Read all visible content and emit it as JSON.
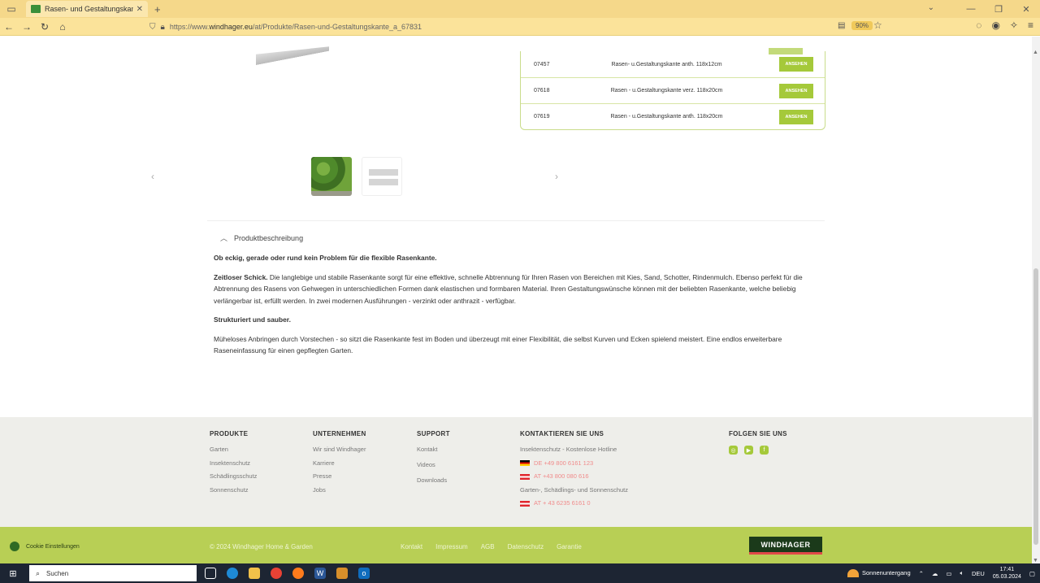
{
  "browser": {
    "tab_title": "Rasen- und Gestaltungskante | W",
    "tab_close": "✕",
    "new_tab": "+",
    "url_prefix": "https://www.",
    "url_domain": "windhager.eu",
    "url_rest": "/at/Produkte/Rasen-und-Gestaltungskante_a_67831",
    "zoom": "90%"
  },
  "variants": [
    {
      "number": "07457",
      "description": "Rasen- u.Gestaltungskante anth. 118x12cm",
      "button": "ANSEHEN"
    },
    {
      "number": "07618",
      "description": "Rasen - u.Gestaltungskante verz. 118x20cm",
      "button": "ANSEHEN"
    },
    {
      "number": "07619",
      "description": "Rasen - u.Gestaltungskante anth. 118x20cm",
      "button": "ANSEHEN"
    }
  ],
  "description": {
    "toggle_label": "Produktbeschreibung",
    "heading": "Ob eckig, gerade oder rund kein Problem für die flexible Rasenkante.",
    "p1_bold": "Zeitloser Schick.",
    "p1_text": " Die langlebige und stabile Rasenkante sorgt für eine effektive, schnelle Abtrennung für Ihren Rasen von Bereichen mit Kies, Sand, Schotter, Rindenmulch. Ebenso perfekt für die Abtrennung des Rasens von Gehwegen in unterschiedlichen Formen dank elastischen und formbaren Material. Ihren Gestaltungswünsche können mit der beliebten Rasenkante, welche beliebig verlängerbar ist, erfüllt werden. In zwei modernen Ausführungen - verzinkt oder anthrazit - verfügbar.",
    "sub_heading": "Strukturiert und sauber.",
    "p2_text": "Müheloses Anbringen durch Vorstechen - so sitzt die Rasenkante fest im Boden und überzeugt mit einer Flexibilität, die selbst Kurven und Ecken spielend meistert. Eine endlos erweiterbare Raseneinfassung für einen gepflegten Garten."
  },
  "footer": {
    "produkte": {
      "title": "PRODUKTE",
      "items": [
        "Garten",
        "Insektenschutz",
        "Schädlingsschutz",
        "Sonnenschutz"
      ]
    },
    "unternehmen": {
      "title": "UNTERNEHMEN",
      "items": [
        "Wir sind Windhager",
        "Karriere",
        "Presse",
        "Jobs"
      ]
    },
    "support": {
      "title": "SUPPORT",
      "items": [
        "Kontakt",
        "Videos",
        "Downloads"
      ]
    },
    "kontakt": {
      "title": "KONTAKTIEREN SIE UNS",
      "line1": "Insektenschutz - Kostenlose Hotline",
      "phone_de": "DE +49 800 6161 123",
      "phone_at": "AT +43 800 080 616",
      "line2": "Garten-, Schädlings- und Sonnenschutz",
      "phone_at2": "AT + 43 6235 6161 0"
    },
    "folgen": {
      "title": "FOLGEN SIE UNS"
    }
  },
  "bottom_bar": {
    "cookie": "Cookie Einstellungen",
    "copyright": "© 2024 Windhager Home & Garden",
    "links": [
      "Kontakt",
      "Impressum",
      "AGB",
      "Datenschutz",
      "Garantie"
    ],
    "logo": "WINDHAGER"
  },
  "taskbar": {
    "search": "Suchen",
    "weather": "Sonnenuntergang",
    "lang": "DEU",
    "time": "17:41",
    "date": "05.03.2024"
  },
  "colors": {
    "accent": "#a5c93a",
    "footer_bar": "#b8cf55",
    "browser_chrome": "#f5d88a"
  }
}
